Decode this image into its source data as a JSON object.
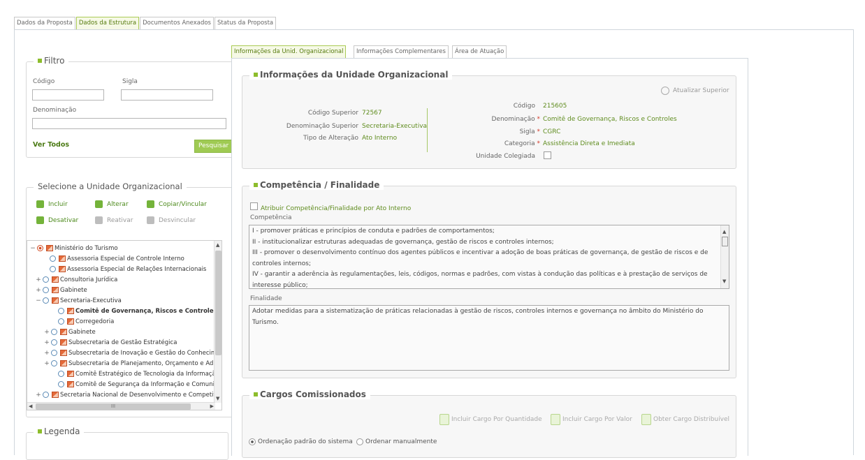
{
  "top_tabs": [
    {
      "label": "Dados da Proposta",
      "active": false
    },
    {
      "label": "Dados da Estrutura",
      "active": true
    },
    {
      "label": "Documentos Anexados",
      "active": false
    },
    {
      "label": "Status da Proposta",
      "active": false
    }
  ],
  "filter": {
    "title": "Filtro",
    "codigo_label": "Código",
    "codigo_value": "",
    "sigla_label": "Sigla",
    "sigla_value": "",
    "denominacao_label": "Denominação",
    "denominacao_value": "",
    "ver_todos": "Ver Todos",
    "search_button": "Pesquisar"
  },
  "org_select": {
    "title": "Selecione a Unidade Organizacional",
    "actions": {
      "incluir": "Incluir",
      "alterar": "Alterar",
      "copiar": "Copiar/Vincular",
      "desativar": "Desativar",
      "reativar": "Reativar",
      "desvincular": "Desvincular"
    },
    "tree": [
      {
        "label": "Ministério do Turismo",
        "expander": "−",
        "selected": true,
        "bold": false
      },
      {
        "label": "Assessoria Especial de Controle Interno",
        "expander": "",
        "selected": false,
        "bold": false
      },
      {
        "label": "Assessoria Especial de Relações Internacionais",
        "expander": "",
        "selected": false,
        "bold": false
      },
      {
        "label": "Consultoria Jurídica",
        "expander": "+",
        "selected": false,
        "bold": false
      },
      {
        "label": "Gabinete",
        "expander": "+",
        "selected": false,
        "bold": false
      },
      {
        "label": "Secretaria-Executiva",
        "expander": "−",
        "selected": false,
        "bold": false
      },
      {
        "label": "Comitê de Governança, Riscos e Controles",
        "expander": "",
        "selected": false,
        "bold": true
      },
      {
        "label": "Corregedoria",
        "expander": "",
        "selected": false,
        "bold": false
      },
      {
        "label": "Gabinete",
        "expander": "+",
        "selected": false,
        "bold": false
      },
      {
        "label": "Subsecretaria de Gestão Estratégica",
        "expander": "+",
        "selected": false,
        "bold": false
      },
      {
        "label": "Subsecretaria de Inovação e Gestão do Conhecimento",
        "expander": "+",
        "selected": false,
        "bold": false
      },
      {
        "label": "Subsecretaria de Planejamento, Orçamento e Administração",
        "expander": "+",
        "selected": false,
        "bold": false
      },
      {
        "label": "Comitê Estratégico de Tecnologia da Informação",
        "expander": "",
        "selected": false,
        "bold": false
      },
      {
        "label": "Comitê de Segurança da Informação e Comunicações",
        "expander": "",
        "selected": false,
        "bold": false
      },
      {
        "label": "Secretaria Nacional de Desenvolvimento e Competitividade do Turismo",
        "expander": "+",
        "selected": false,
        "bold": false
      }
    ]
  },
  "legend_box": {
    "title": "Legenda"
  },
  "inner_tabs": [
    {
      "label": "Informações da Unid. Organizacional",
      "active": true
    },
    {
      "label": "Informações Complementares",
      "active": false
    },
    {
      "label": "Área de Atuação",
      "active": false
    }
  ],
  "unit_info": {
    "title": "Informações da Unidade Organizacional",
    "atualizar": "Atualizar Superior",
    "left": [
      {
        "label": "Código Superior",
        "value": "72567"
      },
      {
        "label": "Denominação Superior",
        "value": "Secretaria-Executiva"
      },
      {
        "label": "Tipo de Alteração",
        "value": "Ato Interno"
      }
    ],
    "right": [
      {
        "label": "Código",
        "value": "215605",
        "required": false
      },
      {
        "label": "Denominação",
        "value": "Comitê de Governança, Riscos e Controles",
        "required": true
      },
      {
        "label": "Sigla",
        "value": "CGRC",
        "required": true
      },
      {
        "label": "Categoria",
        "value": "Assistência Direta e Imediata",
        "required": true
      }
    ],
    "colegiada_label": "Unidade Colegiada",
    "required_mark": "*"
  },
  "competencia": {
    "title": "Competência / Finalidade",
    "checkbox_label": "Atribuir Competência/Finalidade por Ato Interno",
    "competencia_label": "Competência",
    "competencia_lines": [
      "I - promover práticas e princípios de conduta e padrões de comportamentos;",
      "II - institucionalizar estruturas adequadas de governança, gestão de riscos e controles internos;",
      "III - promover o desenvolvimento contínuo dos agentes públicos e incentivar a adoção de boas práticas de governança, de gestão de riscos e de controles internos;",
      "IV - garantir a aderência às regulamentações, leis, códigos, normas e padrões, com vistas à condução das políticas e à prestação de serviços de interesse público;"
    ],
    "finalidade_label": "Finalidade",
    "finalidade_text": "Adotar medidas para a sistematização de práticas relacionadas à gestão de riscos, controles internos e governança no âmbito do Ministério do Turismo."
  },
  "cargos": {
    "title": "Cargos Comissionados",
    "actions": {
      "quantidade": "Incluir Cargo Por Quantidade",
      "valor": "Incluir Cargo Por Valor",
      "distribuivel": "Obter Cargo Distribuível"
    },
    "order_default": "Ordenação padrão do sistema",
    "order_manual": "Ordenar manualmente"
  },
  "scrollbar": {
    "hscroll_grip": "III"
  }
}
